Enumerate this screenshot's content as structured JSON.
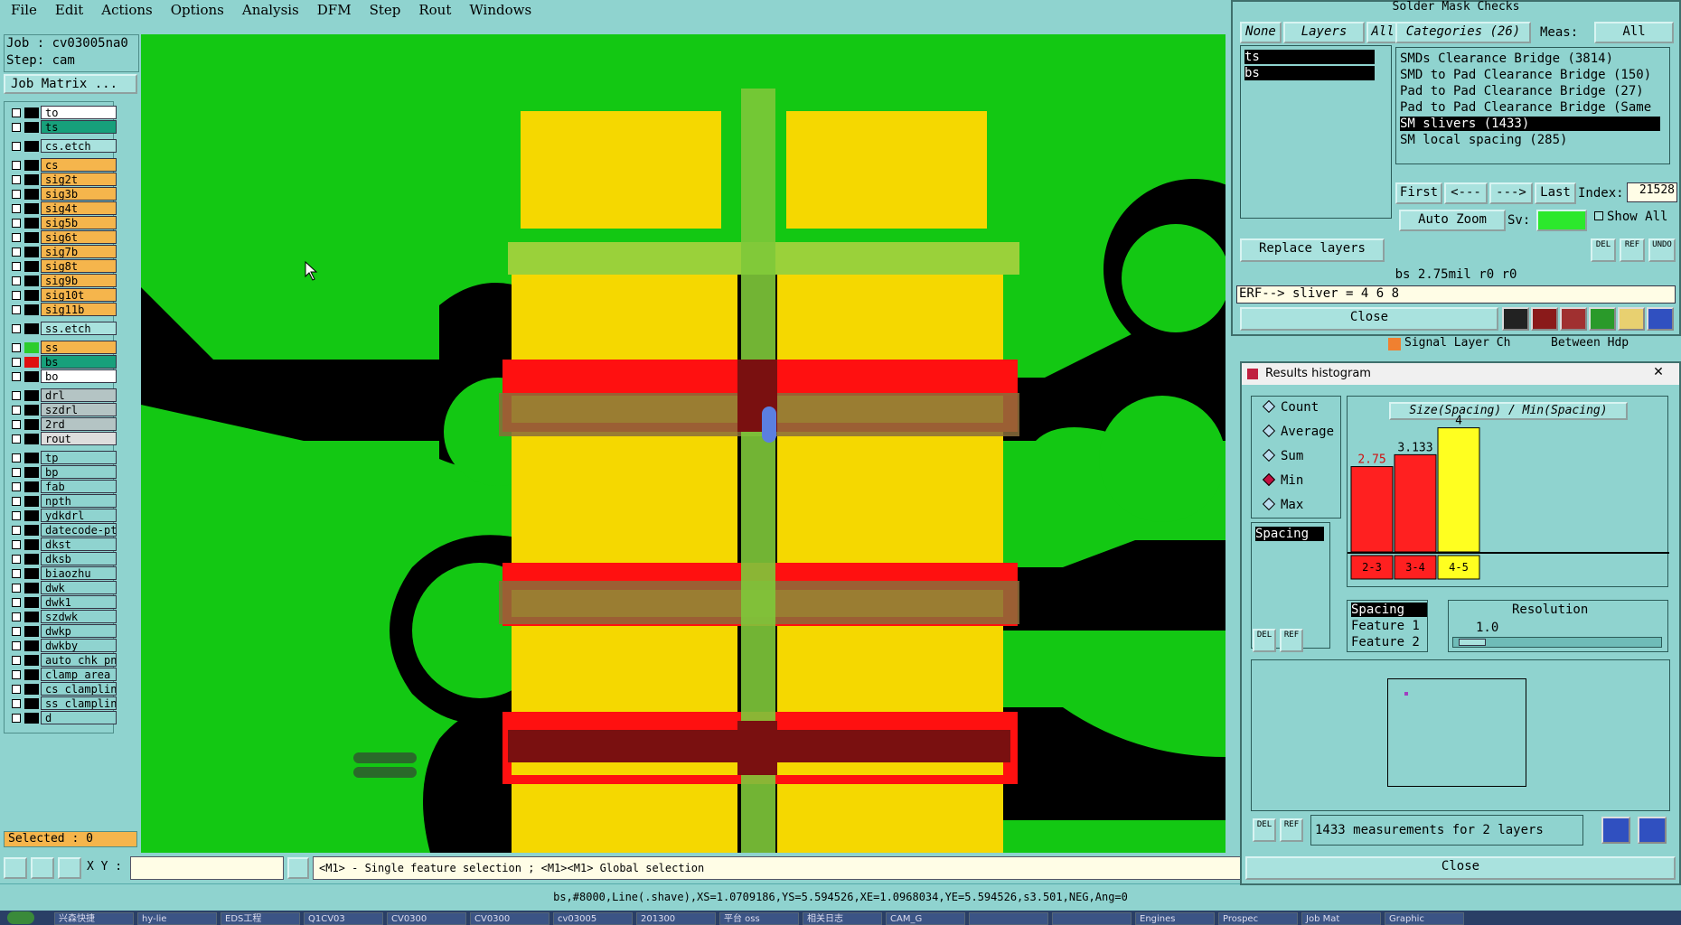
{
  "menubar": [
    "File",
    "Edit",
    "Actions",
    "Options",
    "Analysis",
    "DFM",
    "Step",
    "Rout",
    "Windows"
  ],
  "job": {
    "job_label": "Job : cv03005na0",
    "step_label": "Step: cam",
    "matrix_button": "Job Matrix ..."
  },
  "layers": [
    {
      "name": "to",
      "color": "#ffffff",
      "swatch": "#000000"
    },
    {
      "name": "ts",
      "color": "#17a07b",
      "swatch": "#000000"
    },
    {
      "name": "cs.etch",
      "color": "#a9e2de",
      "swatch": "#000000"
    },
    {
      "name": "cs",
      "color": "#f5b54c",
      "swatch": "#000000"
    },
    {
      "name": "sig2t",
      "color": "#f5b54c",
      "swatch": "#000000"
    },
    {
      "name": "sig3b",
      "color": "#f5b54c",
      "swatch": "#000000"
    },
    {
      "name": "sig4t",
      "color": "#f5b54c",
      "swatch": "#000000"
    },
    {
      "name": "sig5b",
      "color": "#f5b54c",
      "swatch": "#000000"
    },
    {
      "name": "sig6t",
      "color": "#f5b54c",
      "swatch": "#000000"
    },
    {
      "name": "sig7b",
      "color": "#f5b54c",
      "swatch": "#000000"
    },
    {
      "name": "sig8t",
      "color": "#f5b54c",
      "swatch": "#000000"
    },
    {
      "name": "sig9b",
      "color": "#f5b54c",
      "swatch": "#000000"
    },
    {
      "name": "sig10t",
      "color": "#f5b54c",
      "swatch": "#000000"
    },
    {
      "name": "sig11b",
      "color": "#f5b54c",
      "swatch": "#000000"
    },
    {
      "name": "ss.etch",
      "color": "#a9e2de",
      "swatch": "#000000"
    },
    {
      "name": "ss",
      "color": "#f5b54c",
      "swatch": "#2ccd2c"
    },
    {
      "name": "bs",
      "color": "#17a07b",
      "swatch": "#e01010"
    },
    {
      "name": "bo",
      "color": "#ffffff",
      "swatch": "#000000"
    },
    {
      "name": "drl",
      "color": "#b4c4c4",
      "swatch": "#000000"
    },
    {
      "name": "szdrl",
      "color": "#b4c4c4",
      "swatch": "#000000"
    },
    {
      "name": "2rd",
      "color": "#b4c4c4",
      "swatch": "#000000"
    },
    {
      "name": "rout",
      "color": "#dddddd",
      "swatch": "#000000"
    },
    {
      "name": "tp",
      "color": "#8fd3cf",
      "swatch": "#000000"
    },
    {
      "name": "bp",
      "color": "#8fd3cf",
      "swatch": "#000000"
    },
    {
      "name": "fab",
      "color": "#8fd3cf",
      "swatch": "#000000"
    },
    {
      "name": "npth",
      "color": "#8fd3cf",
      "swatch": "#000000"
    },
    {
      "name": "ydkdrl",
      "color": "#8fd3cf",
      "swatch": "#000000"
    },
    {
      "name": "datecode-pt",
      "color": "#8fd3cf",
      "swatch": "#000000"
    },
    {
      "name": "dkst",
      "color": "#8fd3cf",
      "swatch": "#000000"
    },
    {
      "name": "dksb",
      "color": "#8fd3cf",
      "swatch": "#000000"
    },
    {
      "name": "biaozhu",
      "color": "#8fd3cf",
      "swatch": "#000000"
    },
    {
      "name": "dwk",
      "color": "#8fd3cf",
      "swatch": "#000000"
    },
    {
      "name": "dwk1",
      "color": "#8fd3cf",
      "swatch": "#000000"
    },
    {
      "name": "szdwk",
      "color": "#8fd3cf",
      "swatch": "#000000"
    },
    {
      "name": "dwkp",
      "color": "#8fd3cf",
      "swatch": "#000000"
    },
    {
      "name": "dwkby",
      "color": "#8fd3cf",
      "swatch": "#000000"
    },
    {
      "name": "auto_chk_pn",
      "color": "#8fd3cf",
      "swatch": "#000000"
    },
    {
      "name": "clamp_area",
      "color": "#8fd3cf",
      "swatch": "#000000"
    },
    {
      "name": "cs_clampline",
      "color": "#8fd3cf",
      "swatch": "#000000"
    },
    {
      "name": "ss_clampline",
      "color": "#8fd3cf",
      "swatch": "#000000"
    },
    {
      "name": "d",
      "color": "#8fd3cf",
      "swatch": "#000000"
    }
  ],
  "selected_label": "Selected : 0",
  "xy_label": "X Y :",
  "hint": "<M1> - Single feature selection ; <M1><M1> Global selection",
  "status": "bs,#8000,Line(.shave),XS=1.0709186,YS=5.594526,XE=1.0968034,YE=5.594526,s3.501,NEG,Ang=0",
  "checks": {
    "title": "Solder Mask Checks",
    "none_btn": "None",
    "layers_btn": "Layers",
    "all_btn": "All",
    "layer_items": [
      "ts",
      "bs"
    ],
    "categories_label": "Categories (26)",
    "meas_label": "Meas:",
    "meas_value": "All",
    "categories": [
      "SMDs Clearance Bridge (3814)",
      "SMD to Pad Clearance Bridge (150)",
      "Pad to Pad Clearance Bridge (27)",
      "Pad to Pad Clearance Bridge (Same",
      "SM slivers (1433)",
      "SM local spacing (285)"
    ],
    "selected_category": 4,
    "nav": {
      "first": "First",
      "prev": "<---",
      "next": "--->",
      "last": "Last",
      "index_label": "Index:",
      "index_value": "21528"
    },
    "auto_zoom": "Auto Zoom",
    "sv_label": "Sv:",
    "show_all": "Show All",
    "replace_layers": "Replace layers",
    "del": "DEL",
    "ref": "REF",
    "undo": "UNDO",
    "info_line": "bs 2.75mil  r0  r0",
    "erf_line": "ERF--> sliver = 4 6 8",
    "close": "Close",
    "behind_text_1": "Signal Layer Ch",
    "behind_text_2": "Between Hdp"
  },
  "histogram": {
    "title": "Results histogram",
    "radios": [
      "Count",
      "Average",
      "Sum",
      "Min",
      "Max"
    ],
    "radio_selected": 3,
    "chart_title": "Size(Spacing) / Min(Spacing)",
    "list_item": "Spacing",
    "field_list": [
      "Spacing",
      "Feature 1",
      "Feature 2"
    ],
    "resolution_label": "Resolution",
    "resolution_value": "1.0",
    "summary": "1433 measurements for 2 layers",
    "close": "Close",
    "del": "DEL",
    "ref": "REF"
  },
  "chart_data": {
    "type": "bar",
    "title": "Size(Spacing) / Min(Spacing)",
    "categories": [
      "2-3",
      "3-4",
      "4-5"
    ],
    "values": [
      2.75,
      3.133,
      4
    ],
    "value_labels": [
      "2.75",
      "3.133",
      "4"
    ],
    "colors": [
      "#ff2020",
      "#ff2020",
      "#ffff20"
    ],
    "ylim": [
      0,
      4.5
    ]
  },
  "taskbar": [
    "兴森快捷",
    "hy-lie",
    "EDS工程",
    "Q1CV03",
    "CV0300",
    "CV0300",
    "cv03005",
    "201300",
    "平台 oss",
    "相关日志",
    "CAM_G",
    "",
    "",
    "Engines",
    "Prospec",
    "Job Mat",
    "Graphic"
  ],
  "colors": {
    "panel": "#8fd3cf",
    "canvas_bg": "#13c813",
    "pad": "#f5d800",
    "mask_open": "#000000",
    "selected_red": "#ff1010"
  }
}
